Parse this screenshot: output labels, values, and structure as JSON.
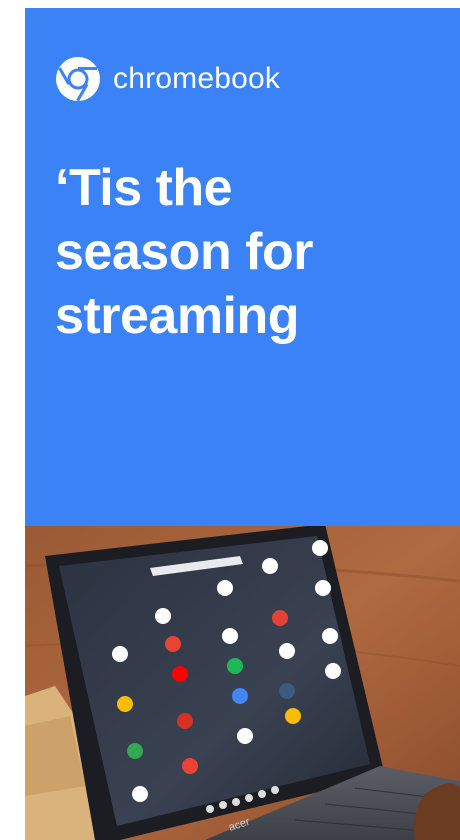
{
  "ad": {
    "brand": "chromebook",
    "headline": [
      "‘Tis the",
      "season for",
      "streaming"
    ],
    "adchoices_icon": "adchoices-icon",
    "close_icon": "close-icon"
  },
  "colors": {
    "background": "#3a82f5",
    "text": "#ffffff"
  },
  "image": {
    "description_icon": "chromebook-laptop-photo",
    "laptop_brand": "acer"
  }
}
